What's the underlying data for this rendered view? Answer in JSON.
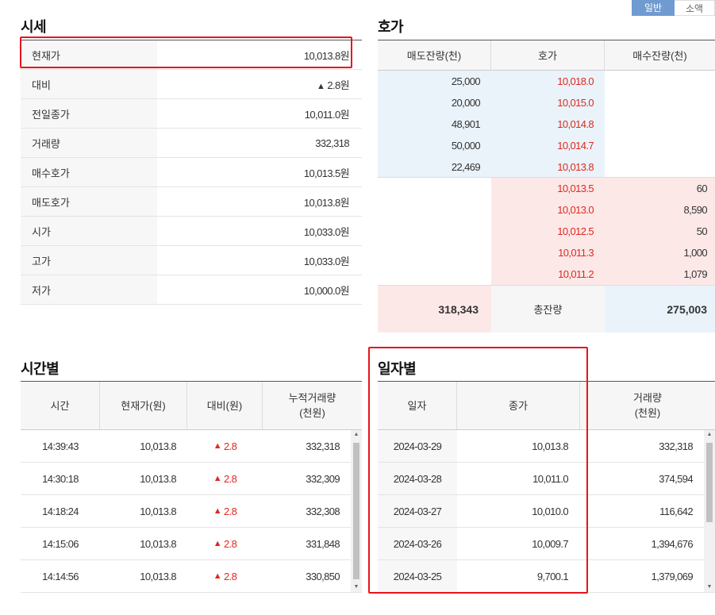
{
  "tabs": [
    {
      "label": "일반",
      "active": true
    },
    {
      "label": "소액",
      "active": false
    }
  ],
  "quote": {
    "title": "시세",
    "rows": [
      {
        "label": "현재가",
        "value": "10,013.8원"
      },
      {
        "label": "대비",
        "arrow": "▲",
        "value": "2.8원"
      },
      {
        "label": "전일종가",
        "value": "10,011.0원"
      },
      {
        "label": "거래량",
        "value": "332,318"
      },
      {
        "label": "매수호가",
        "value": "10,013.5원"
      },
      {
        "label": "매도호가",
        "value": "10,013.8원"
      },
      {
        "label": "시가",
        "value": "10,033.0원"
      },
      {
        "label": "고가",
        "value": "10,033.0원"
      },
      {
        "label": "저가",
        "value": "10,000.0원"
      }
    ]
  },
  "hoga": {
    "title": "호가",
    "headers": [
      "매도잔량(천)",
      "호가",
      "매수잔량(천)"
    ],
    "ask_rows": [
      {
        "qty": "25,000",
        "price": "10,018.0"
      },
      {
        "qty": "20,000",
        "price": "10,015.0"
      },
      {
        "qty": "48,901",
        "price": "10,014.8"
      },
      {
        "qty": "50,000",
        "price": "10,014.7"
      },
      {
        "qty": "22,469",
        "price": "10,013.8"
      }
    ],
    "bid_rows": [
      {
        "price": "10,013.5",
        "qty": "60"
      },
      {
        "price": "10,013.0",
        "qty": "8,590"
      },
      {
        "price": "10,012.5",
        "qty": "50"
      },
      {
        "price": "10,011.3",
        "qty": "1,000"
      },
      {
        "price": "10,011.2",
        "qty": "1,079"
      }
    ],
    "total_ask": "318,343",
    "total_label": "총잔량",
    "total_bid": "275,003"
  },
  "time": {
    "title": "시간별",
    "headers": [
      "시간",
      "현재가(원)",
      "대비(원)",
      "누적거래량\n(천원)"
    ],
    "rows": [
      {
        "time": "14:39:43",
        "price": "10,013.8",
        "arrow": "▲",
        "change": "2.8",
        "volume": "332,318"
      },
      {
        "time": "14:30:18",
        "price": "10,013.8",
        "arrow": "▲",
        "change": "2.8",
        "volume": "332,309"
      },
      {
        "time": "14:18:24",
        "price": "10,013.8",
        "arrow": "▲",
        "change": "2.8",
        "volume": "332,308"
      },
      {
        "time": "14:15:06",
        "price": "10,013.8",
        "arrow": "▲",
        "change": "2.8",
        "volume": "331,848"
      },
      {
        "time": "14:14:56",
        "price": "10,013.8",
        "arrow": "▲",
        "change": "2.8",
        "volume": "330,850"
      }
    ]
  },
  "daily": {
    "title": "일자별",
    "headers": [
      "일자",
      "종가",
      "거래량\n(천원)"
    ],
    "rows": [
      {
        "date": "2024-03-29",
        "close": "10,013.8",
        "volume": "332,318"
      },
      {
        "date": "2024-03-28",
        "close": "10,011.0",
        "volume": "374,594"
      },
      {
        "date": "2024-03-27",
        "close": "10,010.0",
        "volume": "116,642"
      },
      {
        "date": "2024-03-26",
        "close": "10,009.7",
        "volume": "1,394,676"
      },
      {
        "date": "2024-03-25",
        "close": "9,700.1",
        "volume": "1,379,069"
      }
    ]
  },
  "colors": {
    "up": "#e0281e",
    "ask_bg": "#eaf3fa",
    "bid_bg": "#fde8e8",
    "highlight": "#e8141b",
    "tab_active": "#6f9bd1"
  }
}
